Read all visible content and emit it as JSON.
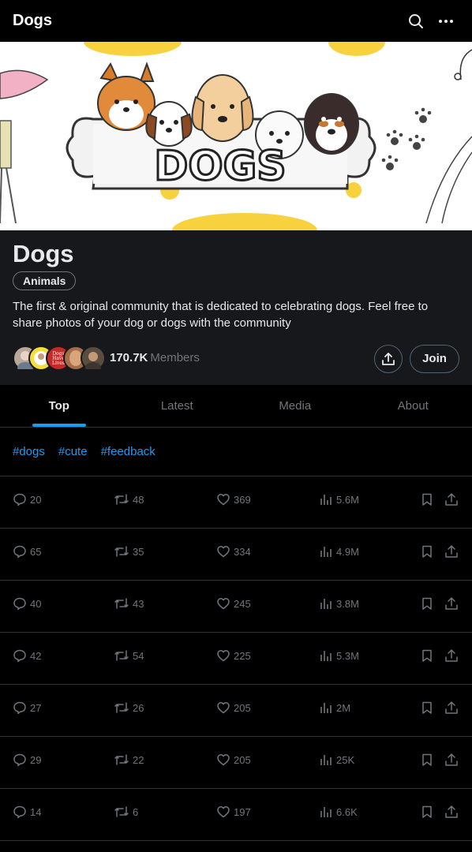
{
  "header": {
    "title": "Dogs",
    "search_icon": "search-icon",
    "more_icon": "more-horizontal-icon"
  },
  "banner": {
    "text": "DOGS"
  },
  "community": {
    "name": "Dogs",
    "category": "Animals",
    "description": "The first & original community that is dedicated to celebrating dogs. Feel free to share photos of your dog or dogs with the community",
    "member_count": "170.7K",
    "member_label": "Members",
    "avatar_badge_text": "Dogs Have Lives",
    "join_label": "Join",
    "share_icon": "share-icon"
  },
  "tabs": [
    {
      "label": "Top",
      "active": true
    },
    {
      "label": "Latest",
      "active": false
    },
    {
      "label": "Media",
      "active": false
    },
    {
      "label": "About",
      "active": false
    }
  ],
  "hashtags": [
    "#dogs",
    "#cute",
    "#feedback"
  ],
  "posts": [
    {
      "replies": "20",
      "reposts": "48",
      "likes": "369",
      "views": "5.6M"
    },
    {
      "replies": "65",
      "reposts": "35",
      "likes": "334",
      "views": "4.9M"
    },
    {
      "replies": "40",
      "reposts": "43",
      "likes": "245",
      "views": "3.8M"
    },
    {
      "replies": "42",
      "reposts": "54",
      "likes": "225",
      "views": "5.3M"
    },
    {
      "replies": "27",
      "reposts": "26",
      "likes": "205",
      "views": "2M"
    },
    {
      "replies": "29",
      "reposts": "22",
      "likes": "205",
      "views": "25K"
    },
    {
      "replies": "14",
      "reposts": "6",
      "likes": "197",
      "views": "6.6K"
    }
  ],
  "colors": {
    "accent": "#1d9bf0",
    "background": "#000000",
    "panel": "#16181c",
    "muted": "#71767b"
  }
}
